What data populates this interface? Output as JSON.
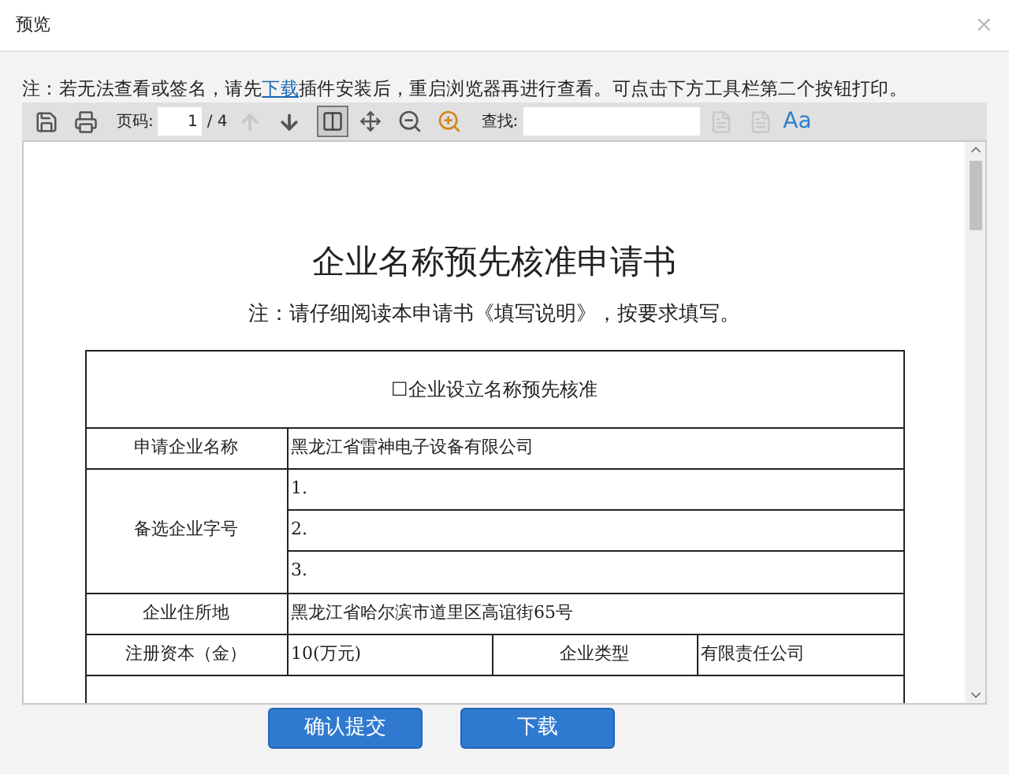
{
  "dialog": {
    "title": "预览",
    "close": "×"
  },
  "notice": {
    "before": "注：若无法查看或签名，请先",
    "link": "下载",
    "after": "插件安装后，重启浏览器再进行查看。可点击下方工具栏第二个按钮打印。"
  },
  "toolbar": {
    "page_label": "页码:",
    "page_value": "1",
    "page_total": "/ 4",
    "prev_disabled": true,
    "next_disabled": false,
    "find_label": "查找:",
    "find_prev_disabled": true,
    "find_next_disabled": true,
    "font_button": "Aa"
  },
  "document": {
    "title": "企业名称预先核准申请书",
    "subtitle": "注：请仔细阅读本申请书《填写说明》，按要求填写。",
    "heading": "☐企业设立名称预先核准",
    "rows": [
      {
        "kind": "single",
        "label": "申请企业名称",
        "value": "黑龙江省雷神电子设备有限公司"
      },
      {
        "kind": "multi",
        "label": "备选企业字号",
        "values": [
          "1.",
          "2.",
          "3."
        ]
      },
      {
        "kind": "single",
        "label": "企业住所地",
        "value": "黑龙江省哈尔滨市道里区高谊街65号"
      },
      {
        "kind": "pair",
        "label": "注册资本（金）",
        "value": "10(万元)",
        "label_2": "企业类型",
        "value_2": "有限责任公司"
      }
    ]
  },
  "buttons": [
    {
      "label": "确认提交"
    },
    {
      "label": "下载"
    }
  ]
}
